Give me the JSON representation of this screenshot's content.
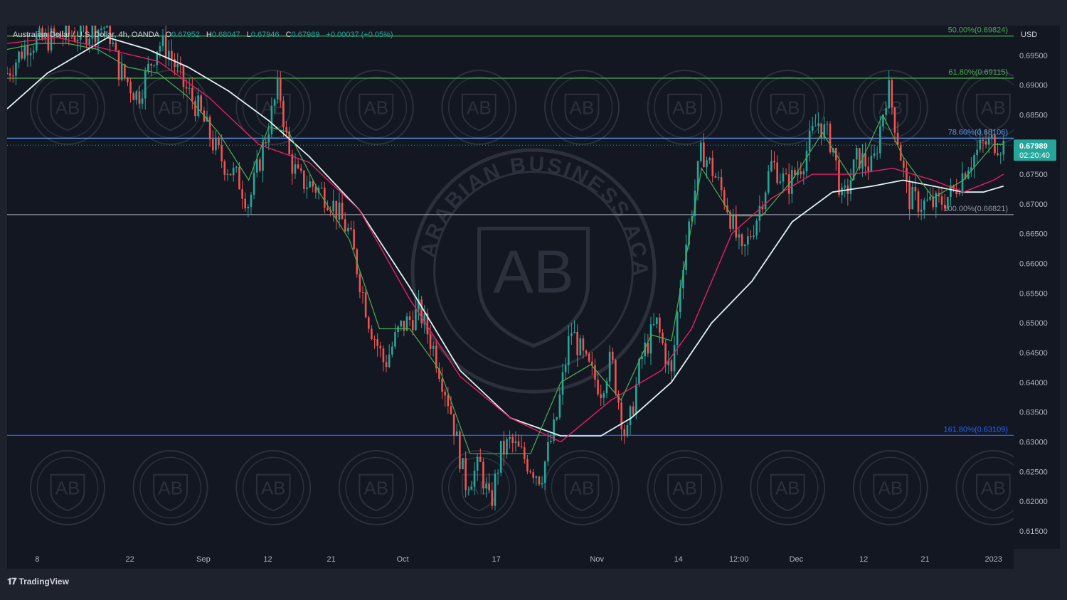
{
  "legend": {
    "symbol": "Australian Dollar / U.S. Dollar, 4h, OANDA",
    "open_key": "O",
    "open": "0.67952",
    "high_key": "H",
    "high": "0.68047",
    "low_key": "L",
    "low": "0.67946",
    "close_key": "C",
    "close": "0.67989",
    "change": "+0.00037 (+0.05%)"
  },
  "currency": "USD",
  "current_price": {
    "value": "0.67989",
    "countdown": "02:20:40",
    "color": "#26a69a"
  },
  "brand": "TradingView",
  "watermark": {
    "big_text": "ARABIAN BUSINESS ACADEMY",
    "big_monogram": "AB",
    "small_text": "ARABIAN BUSINESS ACADEMY",
    "small_monogram": "AB"
  },
  "colors": {
    "up": "#26a69a",
    "down": "#ef5350",
    "ma_fast": "#4caf50",
    "ma_mid": "#e91e63",
    "ma_slow": "#e0f2f1",
    "fib_grey": "#9598a1",
    "fib_green": "#4caf50",
    "fib_blue": "#5b9cf6",
    "fib_deep_blue": "#2962ff"
  },
  "chart_data": {
    "type": "candlestick",
    "title": "Australian Dollar / U.S. Dollar, 4h, OANDA",
    "ylim": [
      0.612,
      0.7
    ],
    "y_ticks": [
      "0.61500",
      "0.62000",
      "0.62500",
      "0.63000",
      "0.63500",
      "0.64000",
      "0.64500",
      "0.65000",
      "0.65500",
      "0.66000",
      "0.66500",
      "0.67000",
      "0.67500",
      "0.68000",
      "0.68500",
      "0.69000",
      "0.69500"
    ],
    "x_ticks": [
      "8",
      "22",
      "Sep",
      "12",
      "21",
      "Oct",
      "17",
      "Nov",
      "14",
      "12:00",
      "Dec",
      "12",
      "21",
      "2023"
    ],
    "x_tick_pos": [
      0.03,
      0.122,
      0.195,
      0.259,
      0.322,
      0.393,
      0.486,
      0.586,
      0.667,
      0.727,
      0.784,
      0.851,
      0.912,
      0.98
    ],
    "fib_levels": [
      {
        "label": "50.00%(0.69824)",
        "value": 0.69824,
        "color": "fib_green"
      },
      {
        "label": "61.80%(0.69115)",
        "value": 0.69115,
        "color": "fib_green"
      },
      {
        "label": "78.60%(0.68106)",
        "value": 0.68106,
        "color": "fib_blue"
      },
      {
        "label": "100.00%(0.66821)",
        "value": 0.66821,
        "color": "fib_grey"
      },
      {
        "label": "161.80%(0.63109)",
        "value": 0.63109,
        "color": "fib_deep_blue"
      }
    ],
    "price_path": [
      [
        0.0,
        0.692
      ],
      [
        0.02,
        0.697
      ],
      [
        0.05,
        0.698
      ],
      [
        0.08,
        0.699
      ],
      [
        0.1,
        0.7
      ],
      [
        0.11,
        0.693
      ],
      [
        0.13,
        0.688
      ],
      [
        0.15,
        0.697
      ],
      [
        0.16,
        0.696
      ],
      [
        0.175,
        0.69
      ],
      [
        0.19,
        0.686
      ],
      [
        0.205,
        0.68
      ],
      [
        0.215,
        0.677
      ],
      [
        0.23,
        0.674
      ],
      [
        0.24,
        0.67
      ],
      [
        0.255,
        0.68
      ],
      [
        0.27,
        0.69
      ],
      [
        0.28,
        0.678
      ],
      [
        0.29,
        0.674
      ],
      [
        0.305,
        0.673
      ],
      [
        0.32,
        0.671
      ],
      [
        0.34,
        0.665
      ],
      [
        0.36,
        0.65
      ],
      [
        0.375,
        0.643
      ],
      [
        0.39,
        0.649
      ],
      [
        0.41,
        0.652
      ],
      [
        0.425,
        0.645
      ],
      [
        0.44,
        0.636
      ],
      [
        0.455,
        0.623
      ],
      [
        0.47,
        0.626
      ],
      [
        0.48,
        0.619
      ],
      [
        0.49,
        0.628
      ],
      [
        0.5,
        0.63
      ],
      [
        0.515,
        0.627
      ],
      [
        0.53,
        0.624
      ],
      [
        0.545,
        0.633
      ],
      [
        0.56,
        0.649
      ],
      [
        0.575,
        0.643
      ],
      [
        0.59,
        0.639
      ],
      [
        0.6,
        0.644
      ],
      [
        0.615,
        0.63
      ],
      [
        0.63,
        0.644
      ],
      [
        0.645,
        0.65
      ],
      [
        0.66,
        0.641
      ],
      [
        0.67,
        0.659
      ],
      [
        0.68,
        0.669
      ],
      [
        0.69,
        0.679
      ],
      [
        0.7,
        0.676
      ],
      [
        0.715,
        0.67
      ],
      [
        0.73,
        0.661
      ],
      [
        0.745,
        0.668
      ],
      [
        0.76,
        0.677
      ],
      [
        0.775,
        0.673
      ],
      [
        0.79,
        0.677
      ],
      [
        0.805,
        0.684
      ],
      [
        0.82,
        0.68
      ],
      [
        0.83,
        0.67
      ],
      [
        0.845,
        0.678
      ],
      [
        0.86,
        0.676
      ],
      [
        0.875,
        0.69
      ],
      [
        0.885,
        0.681
      ],
      [
        0.895,
        0.671
      ],
      [
        0.91,
        0.67
      ],
      [
        0.925,
        0.67
      ],
      [
        0.94,
        0.672
      ],
      [
        0.955,
        0.677
      ],
      [
        0.97,
        0.68
      ],
      [
        0.98,
        0.6805
      ],
      [
        0.99,
        0.6799
      ]
    ],
    "ma_fast_path": [
      [
        0.0,
        0.696
      ],
      [
        0.03,
        0.697
      ],
      [
        0.06,
        0.697
      ],
      [
        0.09,
        0.696
      ],
      [
        0.12,
        0.693
      ],
      [
        0.15,
        0.692
      ],
      [
        0.18,
        0.688
      ],
      [
        0.21,
        0.682
      ],
      [
        0.24,
        0.674
      ],
      [
        0.26,
        0.683
      ],
      [
        0.28,
        0.682
      ],
      [
        0.31,
        0.672
      ],
      [
        0.34,
        0.664
      ],
      [
        0.37,
        0.649
      ],
      [
        0.4,
        0.649
      ],
      [
        0.43,
        0.642
      ],
      [
        0.46,
        0.628
      ],
      [
        0.49,
        0.628
      ],
      [
        0.52,
        0.628
      ],
      [
        0.55,
        0.64
      ],
      [
        0.58,
        0.643
      ],
      [
        0.61,
        0.637
      ],
      [
        0.64,
        0.648
      ],
      [
        0.66,
        0.647
      ],
      [
        0.69,
        0.676
      ],
      [
        0.72,
        0.668
      ],
      [
        0.75,
        0.668
      ],
      [
        0.78,
        0.674
      ],
      [
        0.81,
        0.682
      ],
      [
        0.84,
        0.674
      ],
      [
        0.87,
        0.685
      ],
      [
        0.89,
        0.678
      ],
      [
        0.92,
        0.671
      ],
      [
        0.95,
        0.674
      ],
      [
        0.98,
        0.68
      ],
      [
        0.99,
        0.68
      ]
    ],
    "ma_mid_path": [
      [
        0.0,
        0.697
      ],
      [
        0.05,
        0.698
      ],
      [
        0.1,
        0.696
      ],
      [
        0.15,
        0.694
      ],
      [
        0.2,
        0.688
      ],
      [
        0.25,
        0.68
      ],
      [
        0.3,
        0.677
      ],
      [
        0.35,
        0.669
      ],
      [
        0.4,
        0.654
      ],
      [
        0.45,
        0.641
      ],
      [
        0.5,
        0.634
      ],
      [
        0.55,
        0.63
      ],
      [
        0.6,
        0.637
      ],
      [
        0.65,
        0.642
      ],
      [
        0.68,
        0.649
      ],
      [
        0.72,
        0.665
      ],
      [
        0.76,
        0.671
      ],
      [
        0.8,
        0.675
      ],
      [
        0.84,
        0.675
      ],
      [
        0.88,
        0.676
      ],
      [
        0.92,
        0.674
      ],
      [
        0.95,
        0.672
      ],
      [
        0.98,
        0.674
      ],
      [
        0.99,
        0.675
      ]
    ],
    "ma_slow_path": [
      [
        0.0,
        0.686
      ],
      [
        0.04,
        0.692
      ],
      [
        0.08,
        0.696
      ],
      [
        0.1,
        0.698
      ],
      [
        0.14,
        0.696
      ],
      [
        0.18,
        0.693
      ],
      [
        0.22,
        0.689
      ],
      [
        0.26,
        0.684
      ],
      [
        0.3,
        0.678
      ],
      [
        0.35,
        0.669
      ],
      [
        0.4,
        0.656
      ],
      [
        0.45,
        0.642
      ],
      [
        0.5,
        0.634
      ],
      [
        0.55,
        0.631
      ],
      [
        0.59,
        0.631
      ],
      [
        0.62,
        0.634
      ],
      [
        0.66,
        0.64
      ],
      [
        0.7,
        0.65
      ],
      [
        0.74,
        0.657
      ],
      [
        0.78,
        0.667
      ],
      [
        0.82,
        0.672
      ],
      [
        0.86,
        0.673
      ],
      [
        0.89,
        0.674
      ],
      [
        0.92,
        0.673
      ],
      [
        0.95,
        0.672
      ],
      [
        0.97,
        0.672
      ],
      [
        0.99,
        0.673
      ]
    ]
  }
}
